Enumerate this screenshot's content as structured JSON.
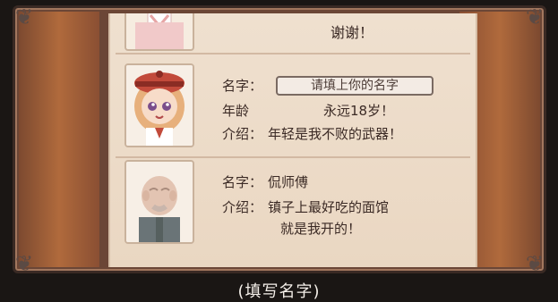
{
  "entry_top": {
    "text": "谢谢！"
  },
  "entry_girl": {
    "name_label": "名字：",
    "name_placeholder": "请填上你的名字",
    "age_label": "年龄",
    "age_value": "永远18岁！",
    "intro_label": "介绍：",
    "intro_value": "年轻是我不败的武器！"
  },
  "entry_old": {
    "name_label": "名字：",
    "name_value": "侃师傅",
    "intro_label": "介绍：",
    "intro_line1": "镇子上最好吃的面馆",
    "intro_line2": "就是我开的！"
  },
  "caption": "(填写名字)",
  "colors": {
    "wood": "#b06a3c",
    "paper": "#efe0cf",
    "text": "#3b2a25"
  }
}
